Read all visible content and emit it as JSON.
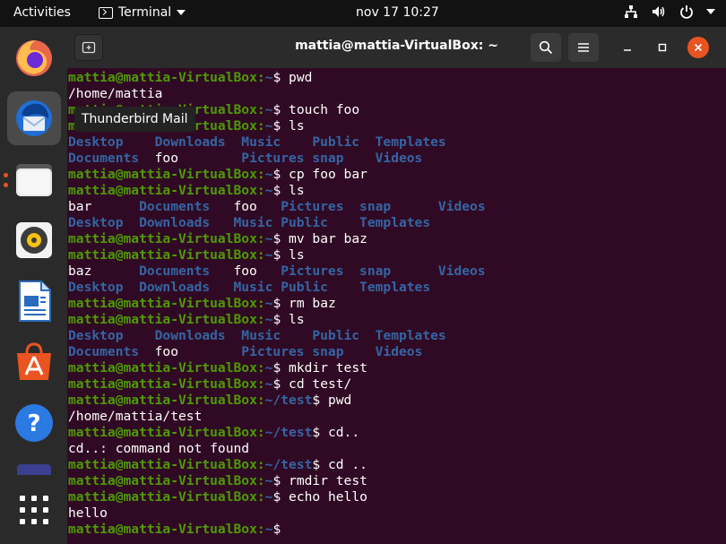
{
  "topbar": {
    "activities": "Activities",
    "app_menu": "Terminal",
    "clock": "nov 17  10:27",
    "icons": [
      "network-icon",
      "volume-icon",
      "power-icon",
      "chevron-down-icon"
    ]
  },
  "dock": {
    "apps": [
      {
        "name": "firefox-icon"
      },
      {
        "name": "thunderbird-icon"
      },
      {
        "name": "files-icon"
      },
      {
        "name": "rhythmbox-icon"
      },
      {
        "name": "libreoffice-writer-icon"
      },
      {
        "name": "software-center-icon"
      },
      {
        "name": "help-icon"
      },
      {
        "name": "show-applications-icon"
      }
    ],
    "tooltip": "Thunderbird Mail"
  },
  "window": {
    "title": "mattia@mattia-VirtualBox: ~",
    "colors": {
      "user": "#4e9a06",
      "path": "#3465a4",
      "background": "#300a24",
      "accent": "#e95420"
    }
  },
  "terminal": {
    "user": "mattia@mattia-VirtualBox",
    "lines": [
      {
        "k": "p",
        "path": "~",
        "cmd": "pwd"
      },
      {
        "k": "o",
        "text": "/home/mattia"
      },
      {
        "k": "p",
        "path": "~",
        "cmd": "touch foo"
      },
      {
        "k": "p",
        "path": "~",
        "cmd": "ls"
      },
      {
        "k": "ls",
        "cells": [
          {
            "t": "Desktop",
            "d": true,
            "w": 11
          },
          {
            "t": "Downloads",
            "d": true,
            "w": 11
          },
          {
            "t": "Music",
            "d": true,
            "w": 9
          },
          {
            "t": "Public",
            "d": true,
            "w": 8
          },
          {
            "t": "Templates",
            "d": true,
            "w": 0
          }
        ]
      },
      {
        "k": "ls",
        "cells": [
          {
            "t": "Documents",
            "d": true,
            "w": 11
          },
          {
            "t": "foo",
            "d": false,
            "w": 11
          },
          {
            "t": "Pictures",
            "d": true,
            "w": 9
          },
          {
            "t": "snap",
            "d": true,
            "w": 8
          },
          {
            "t": "Videos",
            "d": true,
            "w": 0
          }
        ]
      },
      {
        "k": "p",
        "path": "~",
        "cmd": "cp foo bar"
      },
      {
        "k": "p",
        "path": "~",
        "cmd": "ls"
      },
      {
        "k": "ls",
        "cells": [
          {
            "t": "bar",
            "d": false,
            "w": 9
          },
          {
            "t": "Documents",
            "d": true,
            "w": 12
          },
          {
            "t": "foo",
            "d": false,
            "w": 6
          },
          {
            "t": "Pictures",
            "d": true,
            "w": 10
          },
          {
            "t": "snap",
            "d": true,
            "w": 10
          },
          {
            "t": "Videos",
            "d": true,
            "w": 0
          }
        ]
      },
      {
        "k": "ls",
        "cells": [
          {
            "t": "Desktop",
            "d": true,
            "w": 9
          },
          {
            "t": "Downloads",
            "d": true,
            "w": 12
          },
          {
            "t": "Music",
            "d": true,
            "w": 6
          },
          {
            "t": "Public",
            "d": true,
            "w": 10
          },
          {
            "t": "Templates",
            "d": true,
            "w": 0
          }
        ]
      },
      {
        "k": "p",
        "path": "~",
        "cmd": "mv bar baz"
      },
      {
        "k": "p",
        "path": "~",
        "cmd": "ls"
      },
      {
        "k": "ls",
        "cells": [
          {
            "t": "baz",
            "d": false,
            "w": 9
          },
          {
            "t": "Documents",
            "d": true,
            "w": 12
          },
          {
            "t": "foo",
            "d": false,
            "w": 6
          },
          {
            "t": "Pictures",
            "d": true,
            "w": 10
          },
          {
            "t": "snap",
            "d": true,
            "w": 10
          },
          {
            "t": "Videos",
            "d": true,
            "w": 0
          }
        ]
      },
      {
        "k": "ls",
        "cells": [
          {
            "t": "Desktop",
            "d": true,
            "w": 9
          },
          {
            "t": "Downloads",
            "d": true,
            "w": 12
          },
          {
            "t": "Music",
            "d": true,
            "w": 6
          },
          {
            "t": "Public",
            "d": true,
            "w": 10
          },
          {
            "t": "Templates",
            "d": true,
            "w": 0
          }
        ]
      },
      {
        "k": "p",
        "path": "~",
        "cmd": "rm baz"
      },
      {
        "k": "p",
        "path": "~",
        "cmd": "ls"
      },
      {
        "k": "ls",
        "cells": [
          {
            "t": "Desktop",
            "d": true,
            "w": 11
          },
          {
            "t": "Downloads",
            "d": true,
            "w": 11
          },
          {
            "t": "Music",
            "d": true,
            "w": 9
          },
          {
            "t": "Public",
            "d": true,
            "w": 8
          },
          {
            "t": "Templates",
            "d": true,
            "w": 0
          }
        ]
      },
      {
        "k": "ls",
        "cells": [
          {
            "t": "Documents",
            "d": true,
            "w": 11
          },
          {
            "t": "foo",
            "d": false,
            "w": 11
          },
          {
            "t": "Pictures",
            "d": true,
            "w": 9
          },
          {
            "t": "snap",
            "d": true,
            "w": 8
          },
          {
            "t": "Videos",
            "d": true,
            "w": 0
          }
        ]
      },
      {
        "k": "p",
        "path": "~",
        "cmd": "mkdir test"
      },
      {
        "k": "p",
        "path": "~",
        "cmd": "cd test/"
      },
      {
        "k": "p",
        "path": "~/test",
        "cmd": "pwd"
      },
      {
        "k": "o",
        "text": "/home/mattia/test"
      },
      {
        "k": "p",
        "path": "~/test",
        "cmd": "cd.."
      },
      {
        "k": "o",
        "text": "cd..: command not found"
      },
      {
        "k": "p",
        "path": "~/test",
        "cmd": "cd .."
      },
      {
        "k": "p",
        "path": "~",
        "cmd": "rmdir test"
      },
      {
        "k": "p",
        "path": "~",
        "cmd": "echo hello"
      },
      {
        "k": "o",
        "text": "hello"
      },
      {
        "k": "p",
        "path": "~",
        "cmd": ""
      }
    ]
  }
}
